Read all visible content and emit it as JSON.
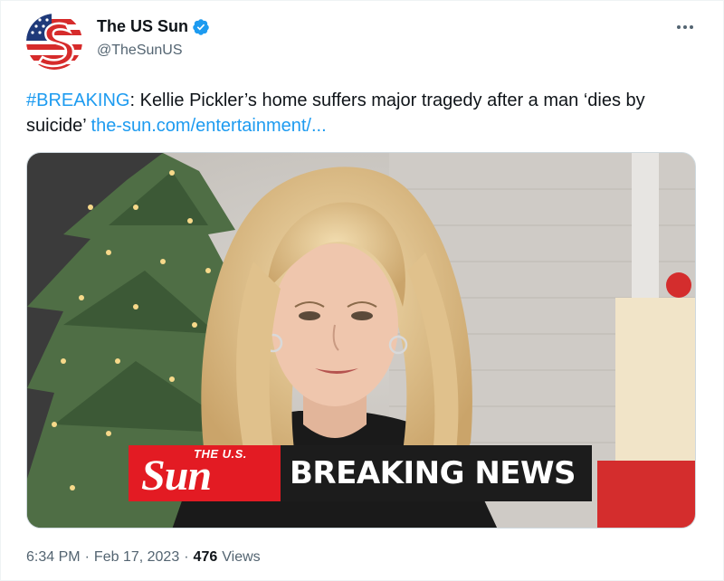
{
  "author": {
    "display_name": "The US Sun",
    "handle": "@TheSunUS",
    "avatar_icon": "us-sun-logo-icon",
    "verified_icon": "verified-badge-icon",
    "verified_color": "#1d9bf0"
  },
  "more_icon": "more-options-icon",
  "tweet": {
    "hashtag": "#BREAKING",
    "text": ": Kellie Pickler’s home suffers major tragedy after a man ‘dies by suicide’ ",
    "link": "the-sun.com/entertainment/..."
  },
  "media": {
    "banner_logo_small": "THE U.S.",
    "banner_logo_big": "Sun",
    "banner_text": "BREAKING NEWS",
    "banner_logo_color": "#e31b23"
  },
  "meta": {
    "time": "6:34 PM",
    "separator": "·",
    "date": "Feb 17, 2023",
    "views_count": "476",
    "views_label": "Views"
  },
  "colors": {
    "link": "#1d9bf0",
    "secondary_text": "#536471",
    "primary_text": "#0f1419"
  }
}
